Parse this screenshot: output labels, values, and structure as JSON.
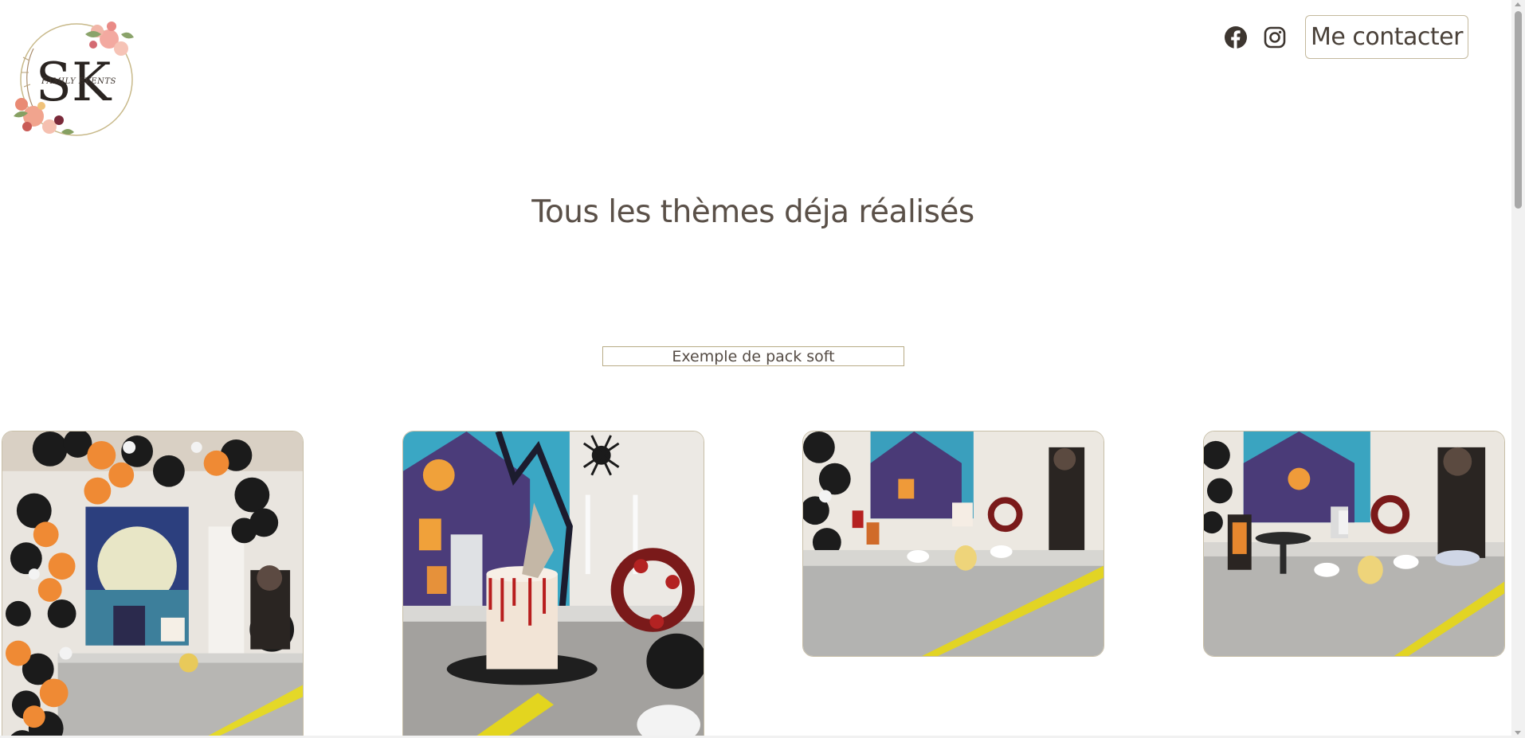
{
  "header": {
    "logo": {
      "monogram": "SK",
      "tagline": "FAMILY EVENTS",
      "icon": "floral-wreath-logo"
    },
    "social": [
      {
        "name": "Facebook",
        "icon": "facebook-icon"
      },
      {
        "name": "Instagram",
        "icon": "instagram-icon"
      }
    ],
    "contact_label": "Me contacter"
  },
  "main": {
    "title": "Tous les thèmes déja réalisés",
    "pack_label": "Exemple de pack soft",
    "gallery": [
      {
        "theme": "halloween",
        "icon": "photo-halloween-balloon-arch"
      },
      {
        "theme": "halloween",
        "icon": "photo-halloween-cake"
      },
      {
        "theme": "halloween",
        "icon": "photo-halloween-table"
      },
      {
        "theme": "halloween",
        "icon": "photo-halloween-table-closeup"
      }
    ]
  },
  "colors": {
    "text": "#544b44",
    "border_gold": "#c4b99d",
    "accent_orange": "#e8893a",
    "accent_black": "#1c1c1c"
  }
}
